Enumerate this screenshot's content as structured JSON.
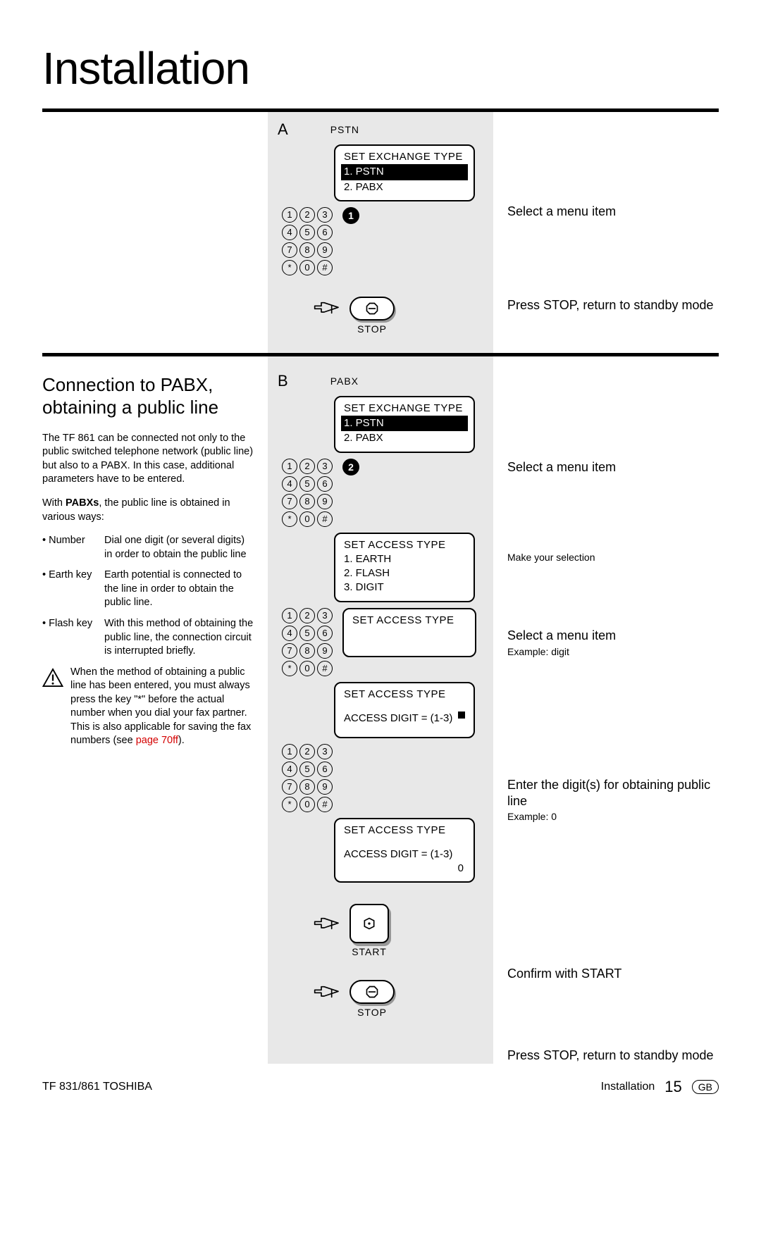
{
  "title": "Installation",
  "sectionA": {
    "letter": "A",
    "tag": "PSTN",
    "screen": {
      "title": "SET EXCHANGE TYPE",
      "opt1": "1. PSTN",
      "opt2": "2. PABX"
    },
    "pressed": "1",
    "stopLabel": "STOP",
    "captions": {
      "c1": "Select a menu item",
      "c2": "Press STOP, return to standby mode"
    }
  },
  "sectionB": {
    "letter": "B",
    "tag": "PABX",
    "screen1": {
      "title": "SET EXCHANGE TYPE",
      "opt1": "1. PSTN",
      "opt2": "2. PABX"
    },
    "pressed": "2",
    "screen2": {
      "title": "SET ACCESS TYPE",
      "opt1": "1. EARTH",
      "opt2": "2. FLASH",
      "opt3": "3. DIGIT"
    },
    "screen3": {
      "title": "SET ACCESS TYPE"
    },
    "screen4": {
      "title": "SET ACCESS TYPE",
      "line": "ACCESS DIGIT = (1-3)"
    },
    "screen5": {
      "title": "SET ACCESS TYPE",
      "line": "ACCESS DIGIT = (1-3)",
      "value": "0"
    },
    "startLabel": "START",
    "stopLabel": "STOP",
    "captions": {
      "c1": "Select a menu item",
      "c2": "Make your selection",
      "c3": "Select a menu item",
      "c3sub": "Example: digit",
      "c4": "Enter the digit(s) for obtaining public line",
      "c4sub": "Example: 0",
      "c5": "Confirm with START",
      "c6": "Press STOP, return to standby mode"
    }
  },
  "side": {
    "heading": "Connection to PABX, obtaining a public line",
    "p1": "The TF 861 can be connected not only to the public switched telephone network (public line) but also to a PABX. In this case, additional parameters have to be entered.",
    "p2a": "With ",
    "p2bold": "PABXs",
    "p2b": ", the public line is obtained in various ways:",
    "items": {
      "number": {
        "term": "Number",
        "desc": "Dial one digit (or several digits) in order to obtain the public line"
      },
      "earth": {
        "term": "Earth key",
        "desc": "Earth potential is connected to the line in order to obtain the public line."
      },
      "flash": {
        "term": "Flash key",
        "desc": "With this method of obtaining the public line, the connection circuit is interrupted briefly."
      }
    },
    "warn": "When the method of obtaining a public line has been entered, you must always press the key \"*\" before the actual number when you dial your fax partner. This is also applicable for saving the fax numbers (see ",
    "warnRef": "page 70ff",
    "warnEnd": ")."
  },
  "keys": [
    "1",
    "2",
    "3",
    "4",
    "5",
    "6",
    "7",
    "8",
    "9",
    "*",
    "0",
    "#"
  ],
  "footer": {
    "left": "TF 831/861 TOSHIBA",
    "section": "Installation",
    "page": "15",
    "region": "GB"
  }
}
